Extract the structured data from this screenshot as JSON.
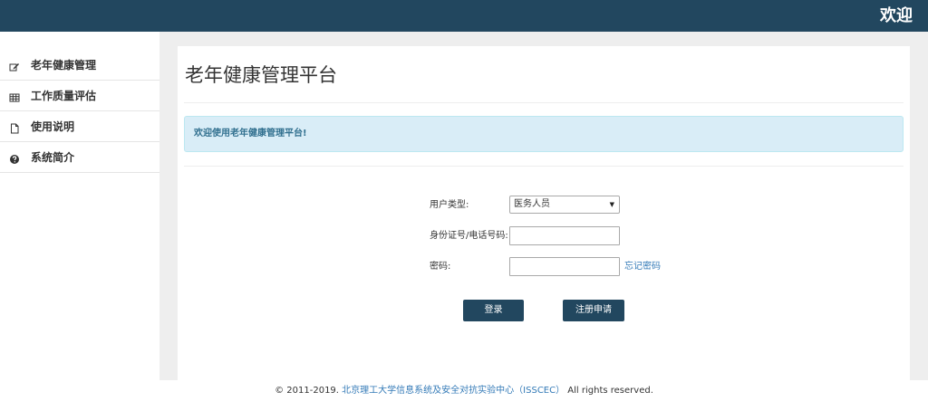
{
  "header": {
    "title": "欢迎",
    "background_color": "#22475f"
  },
  "sidebar": {
    "items": [
      {
        "label": "老年健康管理",
        "icon": "edit-icon"
      },
      {
        "label": "工作质量评估",
        "icon": "table-icon"
      },
      {
        "label": "使用说明",
        "icon": "file-icon"
      },
      {
        "label": "系统简介",
        "icon": "question-circle-icon"
      }
    ]
  },
  "main": {
    "page_title": "老年健康管理平台",
    "alert_text": "欢迎使用老年健康管理平台!",
    "alert_color": "#d9edf7"
  },
  "form": {
    "user_type_label": "用户类型:",
    "user_type_value": "医务人员",
    "id_label": "身份证号/电话号码:",
    "id_value": "",
    "password_label": "密码:",
    "password_value": "",
    "forgot_password_label": "忘记密码",
    "login_label": "登录",
    "register_label": "注册申请"
  },
  "footer": {
    "copyright": "© 2011-2019.",
    "org_link": "北京理工大学信息系统及安全对抗实验中心（ISSCEC）",
    "rights": "All rights reserved."
  }
}
